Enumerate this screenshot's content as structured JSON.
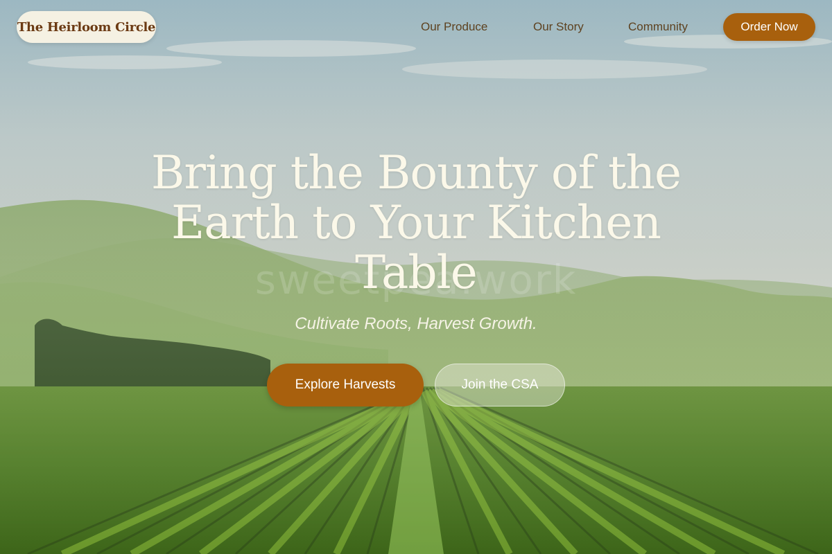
{
  "brand": {
    "name": "The Heirloom Circle"
  },
  "nav": {
    "links": [
      {
        "label": "Our Produce"
      },
      {
        "label": "Our Story"
      },
      {
        "label": "Community"
      }
    ],
    "cta_label": "Order Now"
  },
  "hero": {
    "headline": "Bring the Bounty of the Earth to Your Kitchen Table",
    "tagline": "Cultivate Roots, Harvest Growth.",
    "watermark": "sweetpea.work",
    "primary_button": "Explore Harvests",
    "secondary_button": "Join the CSA",
    "background_icon": "farm-landscape-photo"
  },
  "colors": {
    "accent": "#a8600d",
    "logo_bg": "#f5f1e3",
    "logo_text": "#6b3a13",
    "nav_text": "#5e4220",
    "headline_text": "#fbf8e9"
  }
}
